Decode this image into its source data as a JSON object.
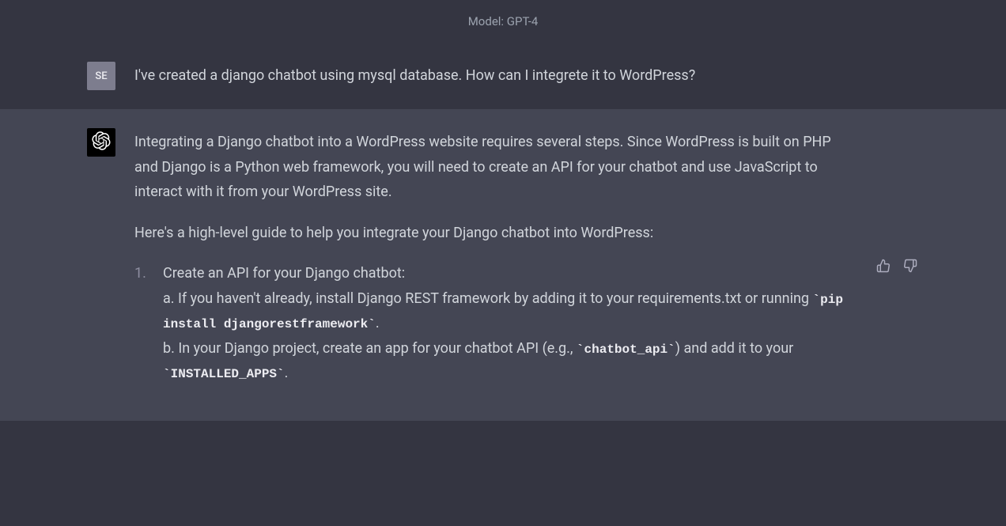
{
  "header": {
    "model_label": "Model: GPT-4"
  },
  "user": {
    "avatar_initials": "SE",
    "message": "I've created a django chatbot using mysql database. How can I integrete it to WordPress?"
  },
  "assistant": {
    "icon_name": "openai-logo",
    "paragraphs": [
      "Integrating a Django chatbot into a WordPress website requires several steps. Since WordPress is built on PHP and Django is a Python web framework, you will need to create an API for your chatbot and use JavaScript to interact with it from your WordPress site.",
      "Here's a high-level guide to help you integrate your Django chatbot into WordPress:"
    ],
    "list_item_1": {
      "title": "Create an API for your Django chatbot:",
      "a_pre": "a. If you haven't already, install Django REST framework by adding it to your requirements.txt or running ",
      "a_code": "pip install djangorestframework",
      "a_post": ".",
      "b_pre": "b. In your Django project, create an app for your chatbot API (e.g., ",
      "b_code1": "chatbot_api",
      "b_mid": ") and add it to your ",
      "b_code2": "INSTALLED_APPS",
      "b_post": "."
    }
  },
  "feedback": {
    "thumbs_up": "thumbs-up",
    "thumbs_down": "thumbs-down"
  }
}
